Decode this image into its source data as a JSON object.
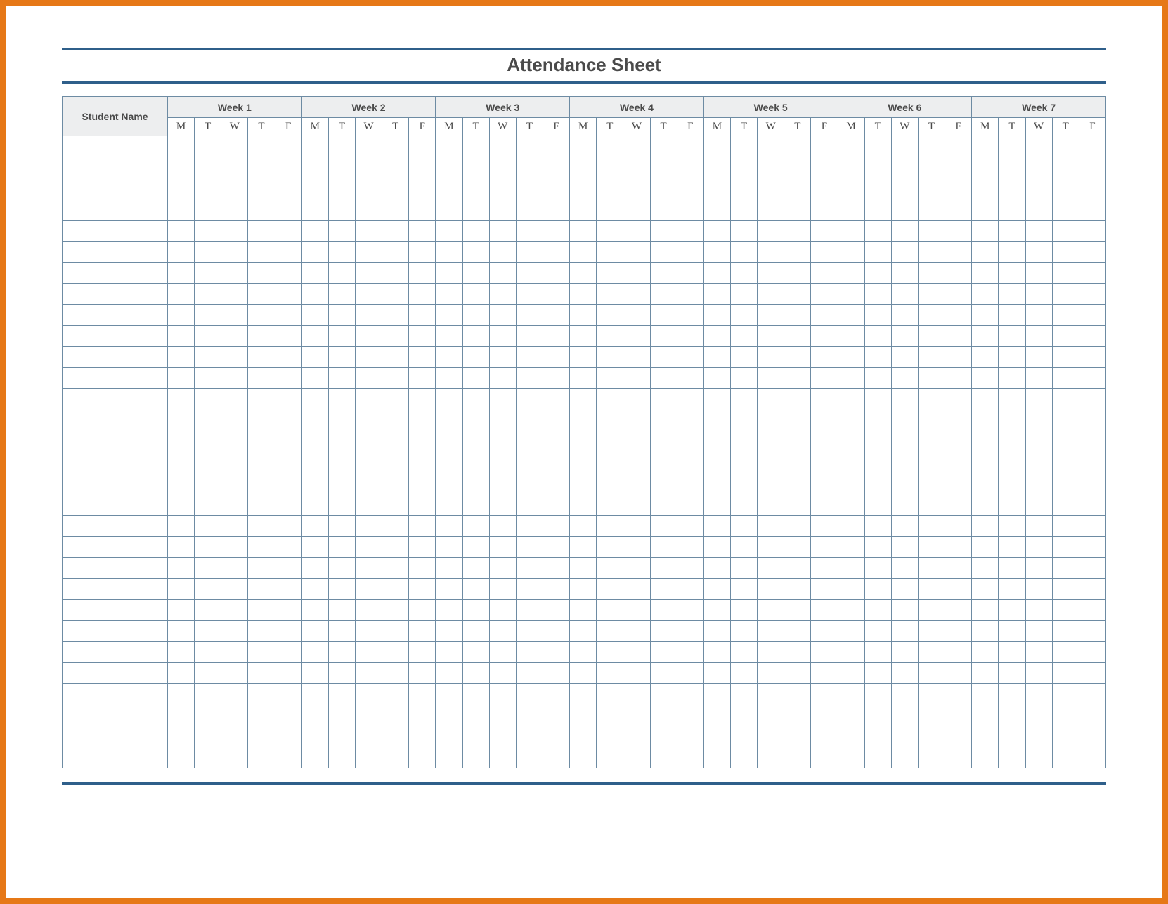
{
  "title": "Attendance Sheet",
  "headers": {
    "student_name": "Student Name",
    "weeks": [
      "Week 1",
      "Week 2",
      "Week 3",
      "Week 4",
      "Week 5",
      "Week 6",
      "Week 7"
    ],
    "days": [
      "M",
      "T",
      "W",
      "T",
      "F"
    ]
  },
  "row_count": 30
}
